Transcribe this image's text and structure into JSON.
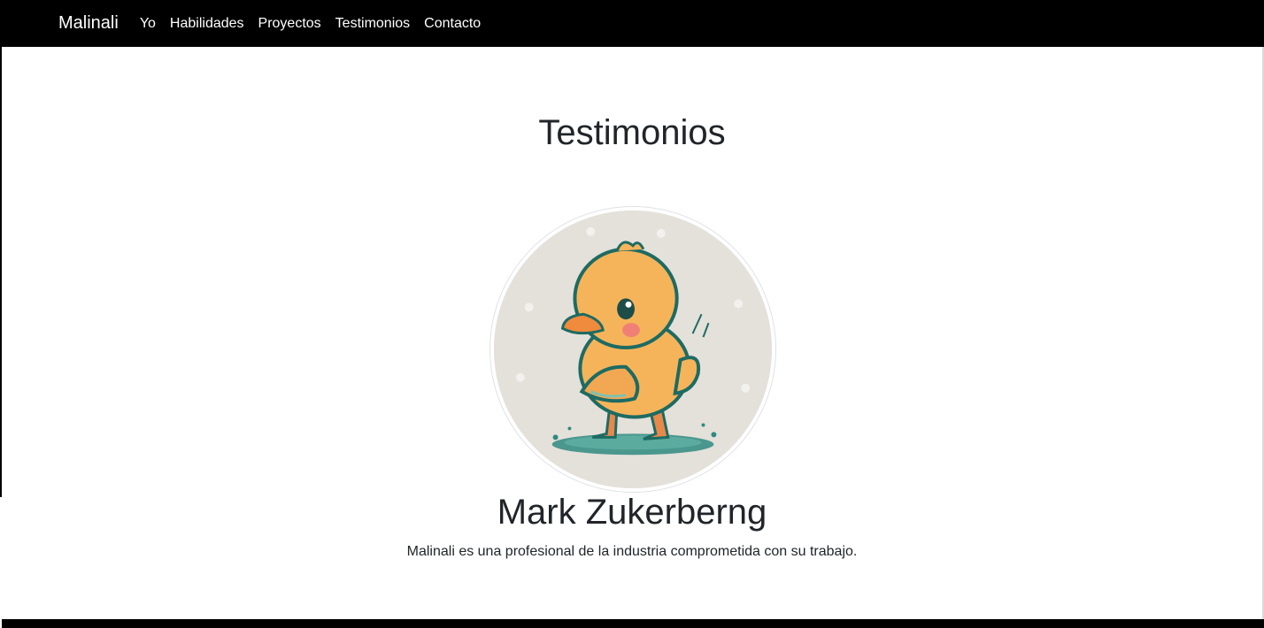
{
  "navbar": {
    "brand": "Malinali",
    "links": [
      "Yo",
      "Habilidades",
      "Proyectos",
      "Testimonios",
      "Contacto"
    ]
  },
  "testimonials": {
    "title": "Testimonios",
    "avatar_icon": "duckling-avatar-icon",
    "name": "Mark Zukerberng",
    "quote": "Malinali es una profesional de la industria comprometida con su trabajo."
  },
  "colors": {
    "navbar_bg": "#000000",
    "nav_text": "#ffffff",
    "text": "#212529",
    "avatar_bg": "#e4e0da",
    "duck_body": "#f6b45a",
    "duck_outline": "#1d6b63"
  }
}
